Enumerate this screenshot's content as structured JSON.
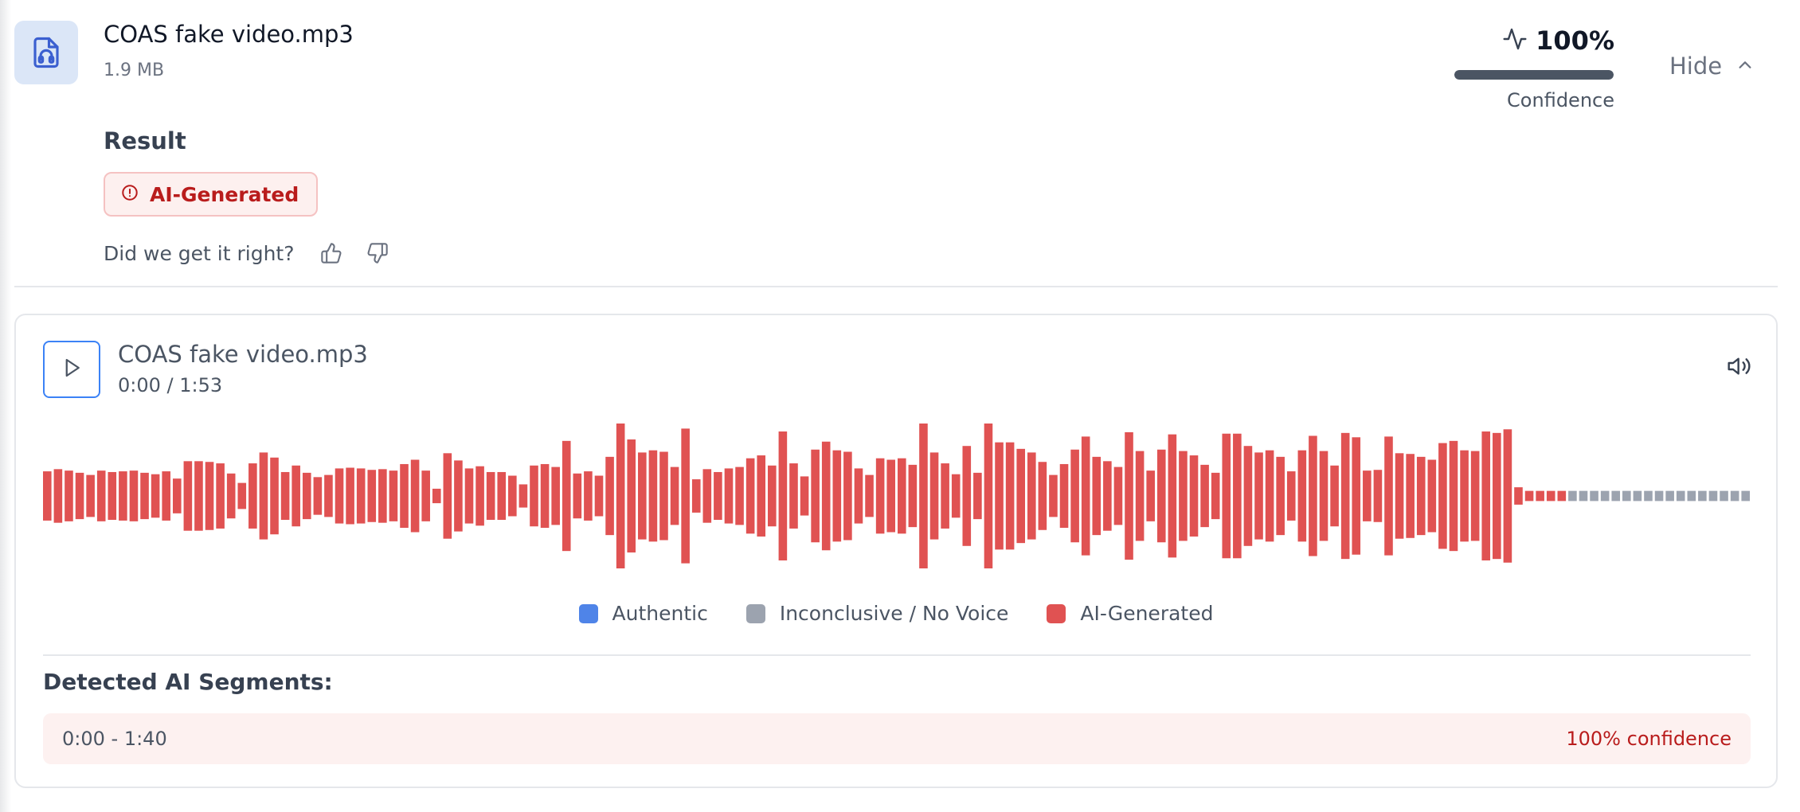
{
  "file": {
    "name": "COAS fake video.mp3",
    "size": "1.9 MB",
    "icon": "audio-file-icon"
  },
  "confidence": {
    "value": "100%",
    "fraction": 1.0,
    "label": "Confidence",
    "icon": "activity-icon"
  },
  "hide": {
    "label": "Hide",
    "icon": "chevron-up-icon"
  },
  "result": {
    "heading": "Result",
    "badge_label": "AI-Generated",
    "badge_icon": "alert-circle-icon",
    "feedback_prompt": "Did we get it right?"
  },
  "player": {
    "title": "COAS fake video.mp3",
    "time": "0:00 / 1:53",
    "play_icon": "play-icon",
    "volume_icon": "volume-icon"
  },
  "waveform": {
    "ai_levels": [
      0.34,
      0.37,
      0.35,
      0.32,
      0.29,
      0.35,
      0.33,
      0.34,
      0.35,
      0.32,
      0.3,
      0.34,
      0.24,
      0.48,
      0.48,
      0.47,
      0.45,
      0.31,
      0.18,
      0.45,
      0.6,
      0.53,
      0.33,
      0.42,
      0.32,
      0.26,
      0.29,
      0.38,
      0.39,
      0.38,
      0.36,
      0.37,
      0.35,
      0.44,
      0.5,
      0.35,
      0.1,
      0.59,
      0.49,
      0.38,
      0.41,
      0.33,
      0.33,
      0.28,
      0.16,
      0.42,
      0.44,
      0.4,
      0.76,
      0.31,
      0.34,
      0.28,
      0.54,
      1.0,
      0.78,
      0.6,
      0.63,
      0.61,
      0.4,
      0.93,
      0.23,
      0.37,
      0.33,
      0.38,
      0.4,
      0.52,
      0.56,
      0.42,
      0.89,
      0.45,
      0.27,
      0.64,
      0.75,
      0.63,
      0.61,
      0.38,
      0.29,
      0.52,
      0.5,
      0.52,
      0.43,
      1.0,
      0.6,
      0.45,
      0.3,
      0.69,
      0.32,
      1.0,
      0.74,
      0.74,
      0.65,
      0.6,
      0.47,
      0.29,
      0.44,
      0.64,
      0.82,
      0.54,
      0.48,
      0.4,
      0.88,
      0.62,
      0.35,
      0.64,
      0.85,
      0.62,
      0.56,
      0.43,
      0.32,
      0.86,
      0.86,
      0.69,
      0.6,
      0.63,
      0.54,
      0.34,
      0.63,
      0.83,
      0.62,
      0.42,
      0.87,
      0.81,
      0.35,
      0.36,
      0.82,
      0.59,
      0.58,
      0.54,
      0.5,
      0.73,
      0.76,
      0.63,
      0.62,
      0.89,
      0.87,
      0.92,
      0.12,
      0.07,
      0.07,
      0.07,
      0.07
    ],
    "ai_trailing_count": 4,
    "inconclusive_count": 17,
    "inconclusive_level": 0.07
  },
  "legend": [
    {
      "label": "Authentic",
      "color": "#4f84e8"
    },
    {
      "label": "Inconclusive / No Voice",
      "color": "#9ca3af"
    },
    {
      "label": "AI-Generated",
      "color": "#e05252"
    }
  ],
  "segments": {
    "heading": "Detected AI Segments:",
    "items": [
      {
        "range": "0:00 - 1:40",
        "confidence": "100% confidence"
      }
    ]
  },
  "colors": {
    "ai": "#e05252",
    "inconclusive": "#9ca3af",
    "authentic": "#4f84e8",
    "accent_blue": "#3b82f6"
  }
}
